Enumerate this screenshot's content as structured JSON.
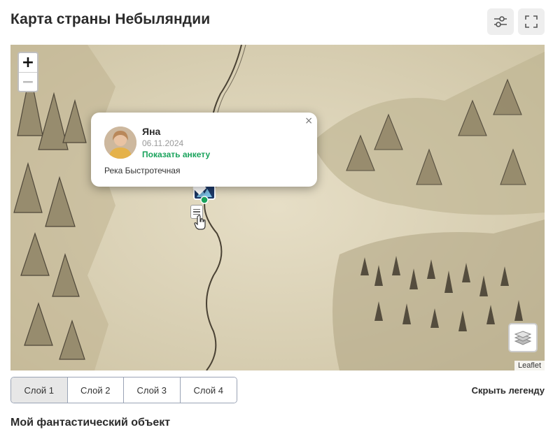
{
  "page": {
    "title": "Карта страны Небыляндии"
  },
  "toolbar": {
    "filter_icon": "sliders-icon",
    "fullscreen_icon": "fullscreen-icon"
  },
  "map": {
    "zoom_in_label": "+",
    "zoom_out_label": "−",
    "attribution": "Leaflet",
    "layers_icon": "layers-icon"
  },
  "popup": {
    "close_label": "×",
    "user_name": "Яна",
    "date": "06.11.2024",
    "profile_link": "Показать анкету",
    "text": "Река Быстротечная"
  },
  "layers": {
    "tabs": [
      {
        "label": "Слой 1",
        "active": true
      },
      {
        "label": "Слой 2",
        "active": false
      },
      {
        "label": "Слой 3",
        "active": false
      },
      {
        "label": "Слой 4",
        "active": false
      }
    ],
    "hide_legend_label": "Скрыть легенду"
  },
  "object": {
    "title": "Мой фантастический объект"
  },
  "colors": {
    "accent_green": "#1aa35c",
    "map_paper": "#ddd4b8",
    "ink": "#3a3328"
  }
}
